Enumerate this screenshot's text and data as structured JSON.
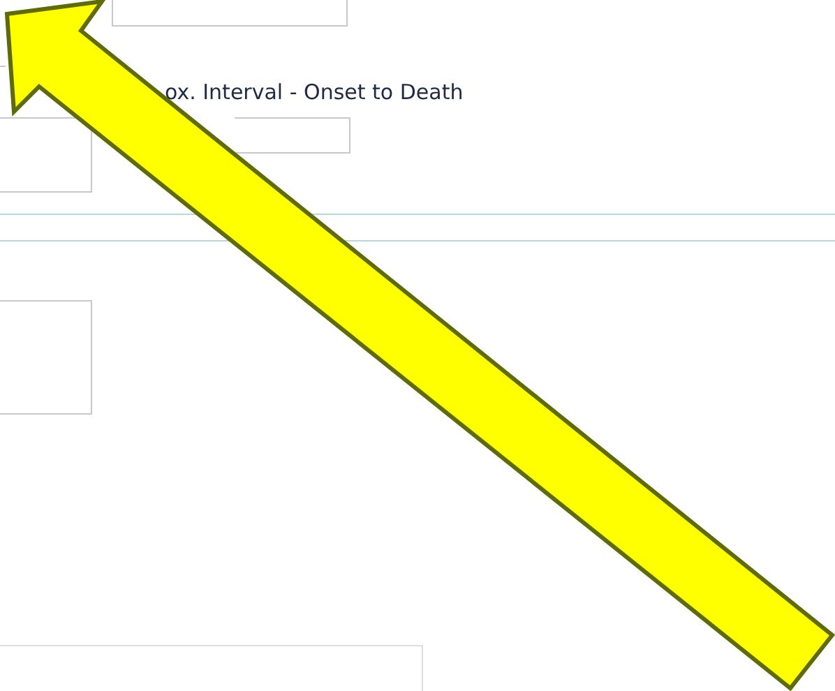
{
  "form": {
    "interval_label": "ox. Interval - Onset to Death"
  }
}
